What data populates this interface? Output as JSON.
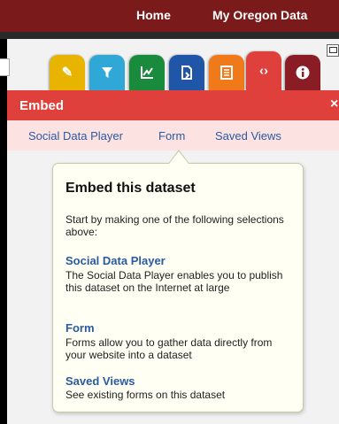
{
  "nav": {
    "home": "Home",
    "my_data": "My Oregon Data"
  },
  "tabs": [
    {
      "name": "pencil-icon",
      "color": "#e8b400"
    },
    {
      "name": "filter-icon",
      "color": "#2fa8d8"
    },
    {
      "name": "chart-icon",
      "color": "#1a8a3c"
    },
    {
      "name": "export-icon",
      "color": "#1f56a8"
    },
    {
      "name": "document-icon",
      "color": "#f07a1a"
    },
    {
      "name": "embed-code-icon",
      "color": "#e0403b"
    },
    {
      "name": "info-icon",
      "color": "#8a1c26"
    }
  ],
  "embed": {
    "title": "Embed",
    "close": "×",
    "subtabs": [
      "Social Data Player",
      "Form",
      "Saved Views"
    ]
  },
  "callout": {
    "heading": "Embed this dataset",
    "intro": "Start by making one of the following selections above:",
    "sections": [
      {
        "title": "Social Data Player",
        "desc": "The Social Data Player enables you to publish this dataset on the Internet at large"
      },
      {
        "title": "Form",
        "desc": "Forms allow you to gather data directly from your website into a dataset"
      },
      {
        "title": "Saved Views",
        "desc": "See existing forms on this dataset"
      }
    ]
  }
}
